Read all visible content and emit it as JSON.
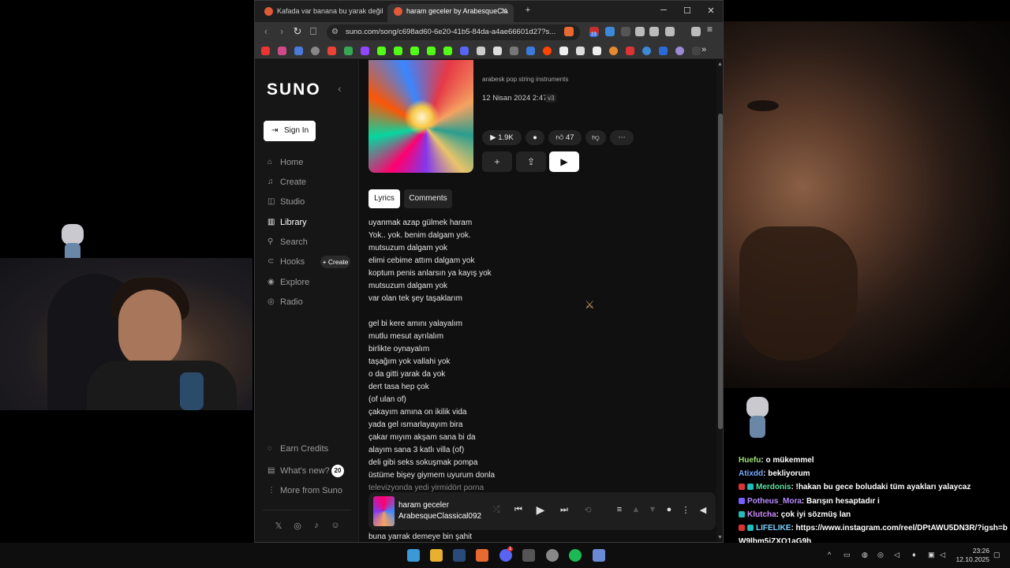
{
  "browser": {
    "tabs": [
      {
        "title": "Kafada var banana bu yarak değil res"
      },
      {
        "title": "haram geceler by ArabesqueCla"
      }
    ],
    "url": "suno.com/song/c698ad60-6e20-41b5-84da-a4ae66601d27?s...",
    "new_tab": "+",
    "window_controls": {
      "minimize": "─",
      "maximize": "☐",
      "close": "✕"
    },
    "shields_count": "23",
    "bookmarks_overflow": "»"
  },
  "sidebar": {
    "logo": "SUNO",
    "sign_in": "Sign In",
    "nav": [
      {
        "label": "Home",
        "icon": "home-icon"
      },
      {
        "label": "Create",
        "icon": "music-note-icon"
      },
      {
        "label": "Studio",
        "icon": "studio-icon"
      },
      {
        "label": "Library",
        "icon": "library-icon",
        "active": true
      },
      {
        "label": "Search",
        "icon": "search-icon"
      },
      {
        "label": "Hooks",
        "icon": "hooks-icon"
      },
      {
        "label": "Explore",
        "icon": "compass-icon"
      },
      {
        "label": "Radio",
        "icon": "radio-icon"
      }
    ],
    "hooks_create": "+ Create",
    "bottom": [
      {
        "label": "Earn Credits",
        "icon": "coins-icon"
      },
      {
        "label": "What's new?",
        "icon": "news-icon"
      },
      {
        "label": "More from Suno",
        "icon": "more-vertical-icon"
      }
    ],
    "whats_new_count": "20"
  },
  "song": {
    "tags": "arabesk pop string instruments",
    "date": "12 Nisan 2024 2:47",
    "version": "v3",
    "plays": "1.9K",
    "likes": "47"
  },
  "tabs": {
    "lyrics": "Lyrics",
    "comments": "Comments"
  },
  "lyrics": [
    "uyanmak azap gülmek haram",
    "Yok.. yok. benim dalgam yok.",
    "mutsuzum dalgam yok",
    "elimi cebime attım dalgam yok",
    "koptum penis anlarsın ya kayış yok",
    "mutsuzum dalgam yok",
    "var olan tek şey taşaklarım",
    "",
    "gel bi kere amını yalayalım",
    "mutlu mesut ayrılalım",
    "birlikte oynayalım",
    "taşağım yok vallahi yok",
    "o da gitti yarak da yok",
    "dert tasa hep çok",
    "(of ulan of)",
    "çakayım amına on ikilik vida",
    "yada gel ısmarlayayım bira",
    "çakar mıyım akşam sana bi da",
    "alayım sana 3 katlı villa (of)",
    "deli gibi seks sokuşmak pompa",
    "üstüme bişey giymem uyurum donla",
    "televizyonda yedi yirmidört porna"
  ],
  "lyrics_after_player": "buna yarrak demeye bin şahit",
  "player": {
    "title": "haram geceler",
    "artist": "ArabesqueClassical092"
  },
  "chat": [
    {
      "user": "",
      "color": "#9ee07a",
      "message": ": o mükemmel",
      "user_label": "Huefu"
    },
    {
      "user": "Atixdd",
      "color": "#7aa8ff",
      "message": ": bekliyorum"
    },
    {
      "user": "Merdonis",
      "color": "#5be0a0",
      "message": ": !hakan bu gece boludaki tüm ayakları yalaycaz"
    },
    {
      "user": "Potheus_Mora",
      "color": "#b98cff",
      "message": ": Barışın hesaptadır i"
    },
    {
      "user": "Klutcha",
      "color": "#d48cff",
      "message": ": çok iyi sözmüş lan"
    },
    {
      "user": "LIFELIKE",
      "color": "#7ad0ff",
      "message": ": https://www.instagram.com/reel/DPtAWU5DN3R/?igsh=bW9lbm5iZXQ1aG9h"
    }
  ],
  "taskbar": {
    "time": "23:26",
    "date": "12.10.2025",
    "discord_badge": "1"
  }
}
